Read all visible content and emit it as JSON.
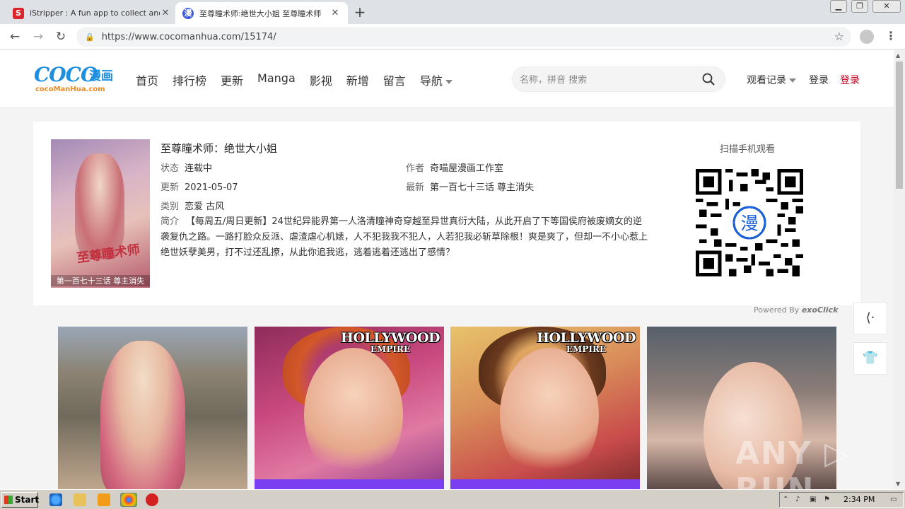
{
  "browser": {
    "tabs": [
      {
        "title": "iStripper : A fun app to collect and w",
        "favicon_color": "#d9252b",
        "favicon_letter": "S"
      },
      {
        "title": "至尊瞳术师:绝世大小姐 至尊瞳术师",
        "favicon_color": "#3b5bd6",
        "favicon_letter": "漫"
      }
    ],
    "url": "https://www.cocomanhua.com/15174/",
    "new_tab_symbol": "+",
    "close_symbol": "✕"
  },
  "site": {
    "logo_main": "COCO",
    "logo_cn": "漫画",
    "logo_sub": "cocoManHua.com",
    "nav": [
      "首页",
      "排行榜",
      "更新",
      "Manga",
      "影视",
      "新增",
      "留言",
      "导航"
    ],
    "search_placeholder": "名称，拼音 搜索",
    "history": "观看记录",
    "login": "登录",
    "register": "登录",
    "accent": "#c5001f",
    "brand": "#1d8fe0"
  },
  "comic": {
    "title": "至尊瞳术师：绝世大小姐",
    "status_label": "状态",
    "status": "连载中",
    "author_label": "作者",
    "author": "奇喵屋漫画工作室",
    "updated_label": "更新",
    "updated": "2021-05-07",
    "latest_label": "最新",
    "latest": "第一百七十三话 尊主消失",
    "category_label": "类别",
    "category": "恋爱 古风",
    "intro_label": "简介",
    "intro": "【每周五/周日更新】24世纪异能界第一人洛清瞳神奇穿越至异世真衍大陆，从此开启了下等国侯府被废嫡女的逆袭复仇之路。一路打脸众反派、虐渣虐心机婊，人不犯我我不犯人，人若犯我必斩草除根！爽是爽了，但却一不小心惹上绝世妖孽美男，打不过还乱撩，从此你追我逃，逃着逃着还逃出了感情？",
    "cover_caption": "第一百七十三话 尊主消失",
    "cover_calligraphy": "至尊瞳术师",
    "qr_title": "扫描手机观看"
  },
  "ads": {
    "powered_prefix": "Powered By",
    "powered_brand": "exoClick",
    "hollywood_line1": "HOLLYWOOD",
    "hollywood_line2": "EMPIRE"
  },
  "watermark": "ANY ▷ RUN",
  "taskbar": {
    "start": "Start",
    "clock": "2:34 PM"
  }
}
